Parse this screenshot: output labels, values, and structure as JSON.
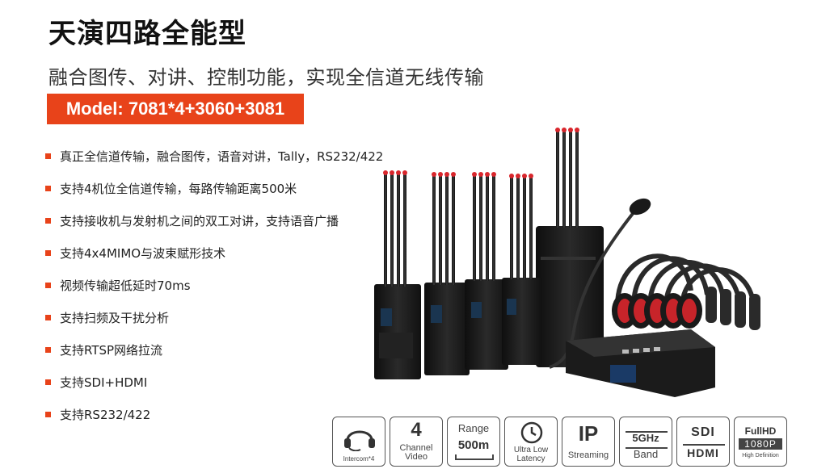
{
  "title": "天演四路全能型",
  "subtitle": "融合图传、对讲、控制功能，实现全信道无线传输",
  "model": "Model: 7081*4+3060+3081",
  "features": [
    "真正全信道传输，融合图传，语音对讲，Tally，RS232/422",
    "支持4机位全信道传输，每路传输距离500米",
    "支持接收机与发射机之间的双工对讲，支持语音广播",
    "支持4x4MIMO与波束赋形技术",
    "视频传输超低延时70ms",
    "支持扫频及干扰分析",
    "支持RTSP网络拉流",
    "支持SDI+HDMI",
    "支持RS232/422"
  ],
  "badges": {
    "intercom": {
      "label": "Intercom*4",
      "icon": "headset-icon"
    },
    "channel": {
      "number": "4",
      "line1": "Channel",
      "line2": "Video"
    },
    "range": {
      "line1": "Range",
      "line2": "500m"
    },
    "latency": {
      "line1": "Ultra Low",
      "line2": "Latency",
      "icon": "clock-icon"
    },
    "ip": {
      "big": "IP",
      "small": "Streaming"
    },
    "band": {
      "big": "5GHz",
      "small": "Band"
    },
    "sdi": {
      "line1": "SDI",
      "line2": "HDMI"
    },
    "fullhd": {
      "line1": "FullHD",
      "line2": "1080P",
      "line3": "High Definition"
    }
  },
  "colors": {
    "accent": "#e8431a",
    "device": "#1c1c1c",
    "antenna_tip": "#d9262c"
  }
}
